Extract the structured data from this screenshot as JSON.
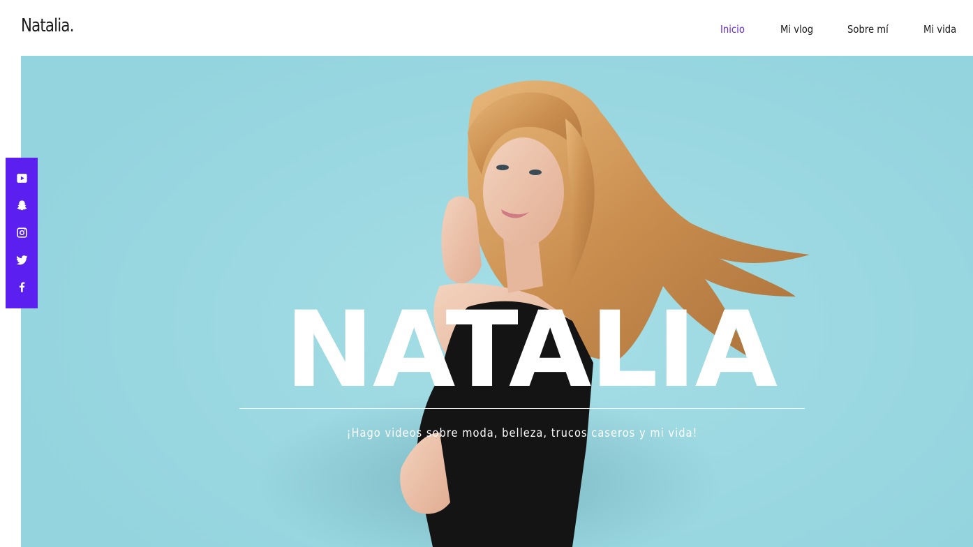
{
  "site": {
    "logo": "Natalia."
  },
  "nav": {
    "items": [
      {
        "label": "Inicio",
        "active": true
      },
      {
        "label": "Mi vlog",
        "active": false
      },
      {
        "label": "Sobre mí",
        "active": false
      },
      {
        "label": "Mi vida",
        "active": false
      }
    ]
  },
  "hero": {
    "title": "NATALIA",
    "subtitle": "¡Hago videos sobre moda, belleza, trucos caseros y mi vida!",
    "background_color": "#9dd9e2"
  },
  "social": {
    "background_color": "#5b1ff0",
    "icons": [
      "youtube-icon",
      "snapchat-icon",
      "instagram-icon",
      "twitter-icon",
      "facebook-icon"
    ]
  },
  "colors": {
    "accent": "#6a2bd9",
    "text": "#1a1a1a"
  }
}
